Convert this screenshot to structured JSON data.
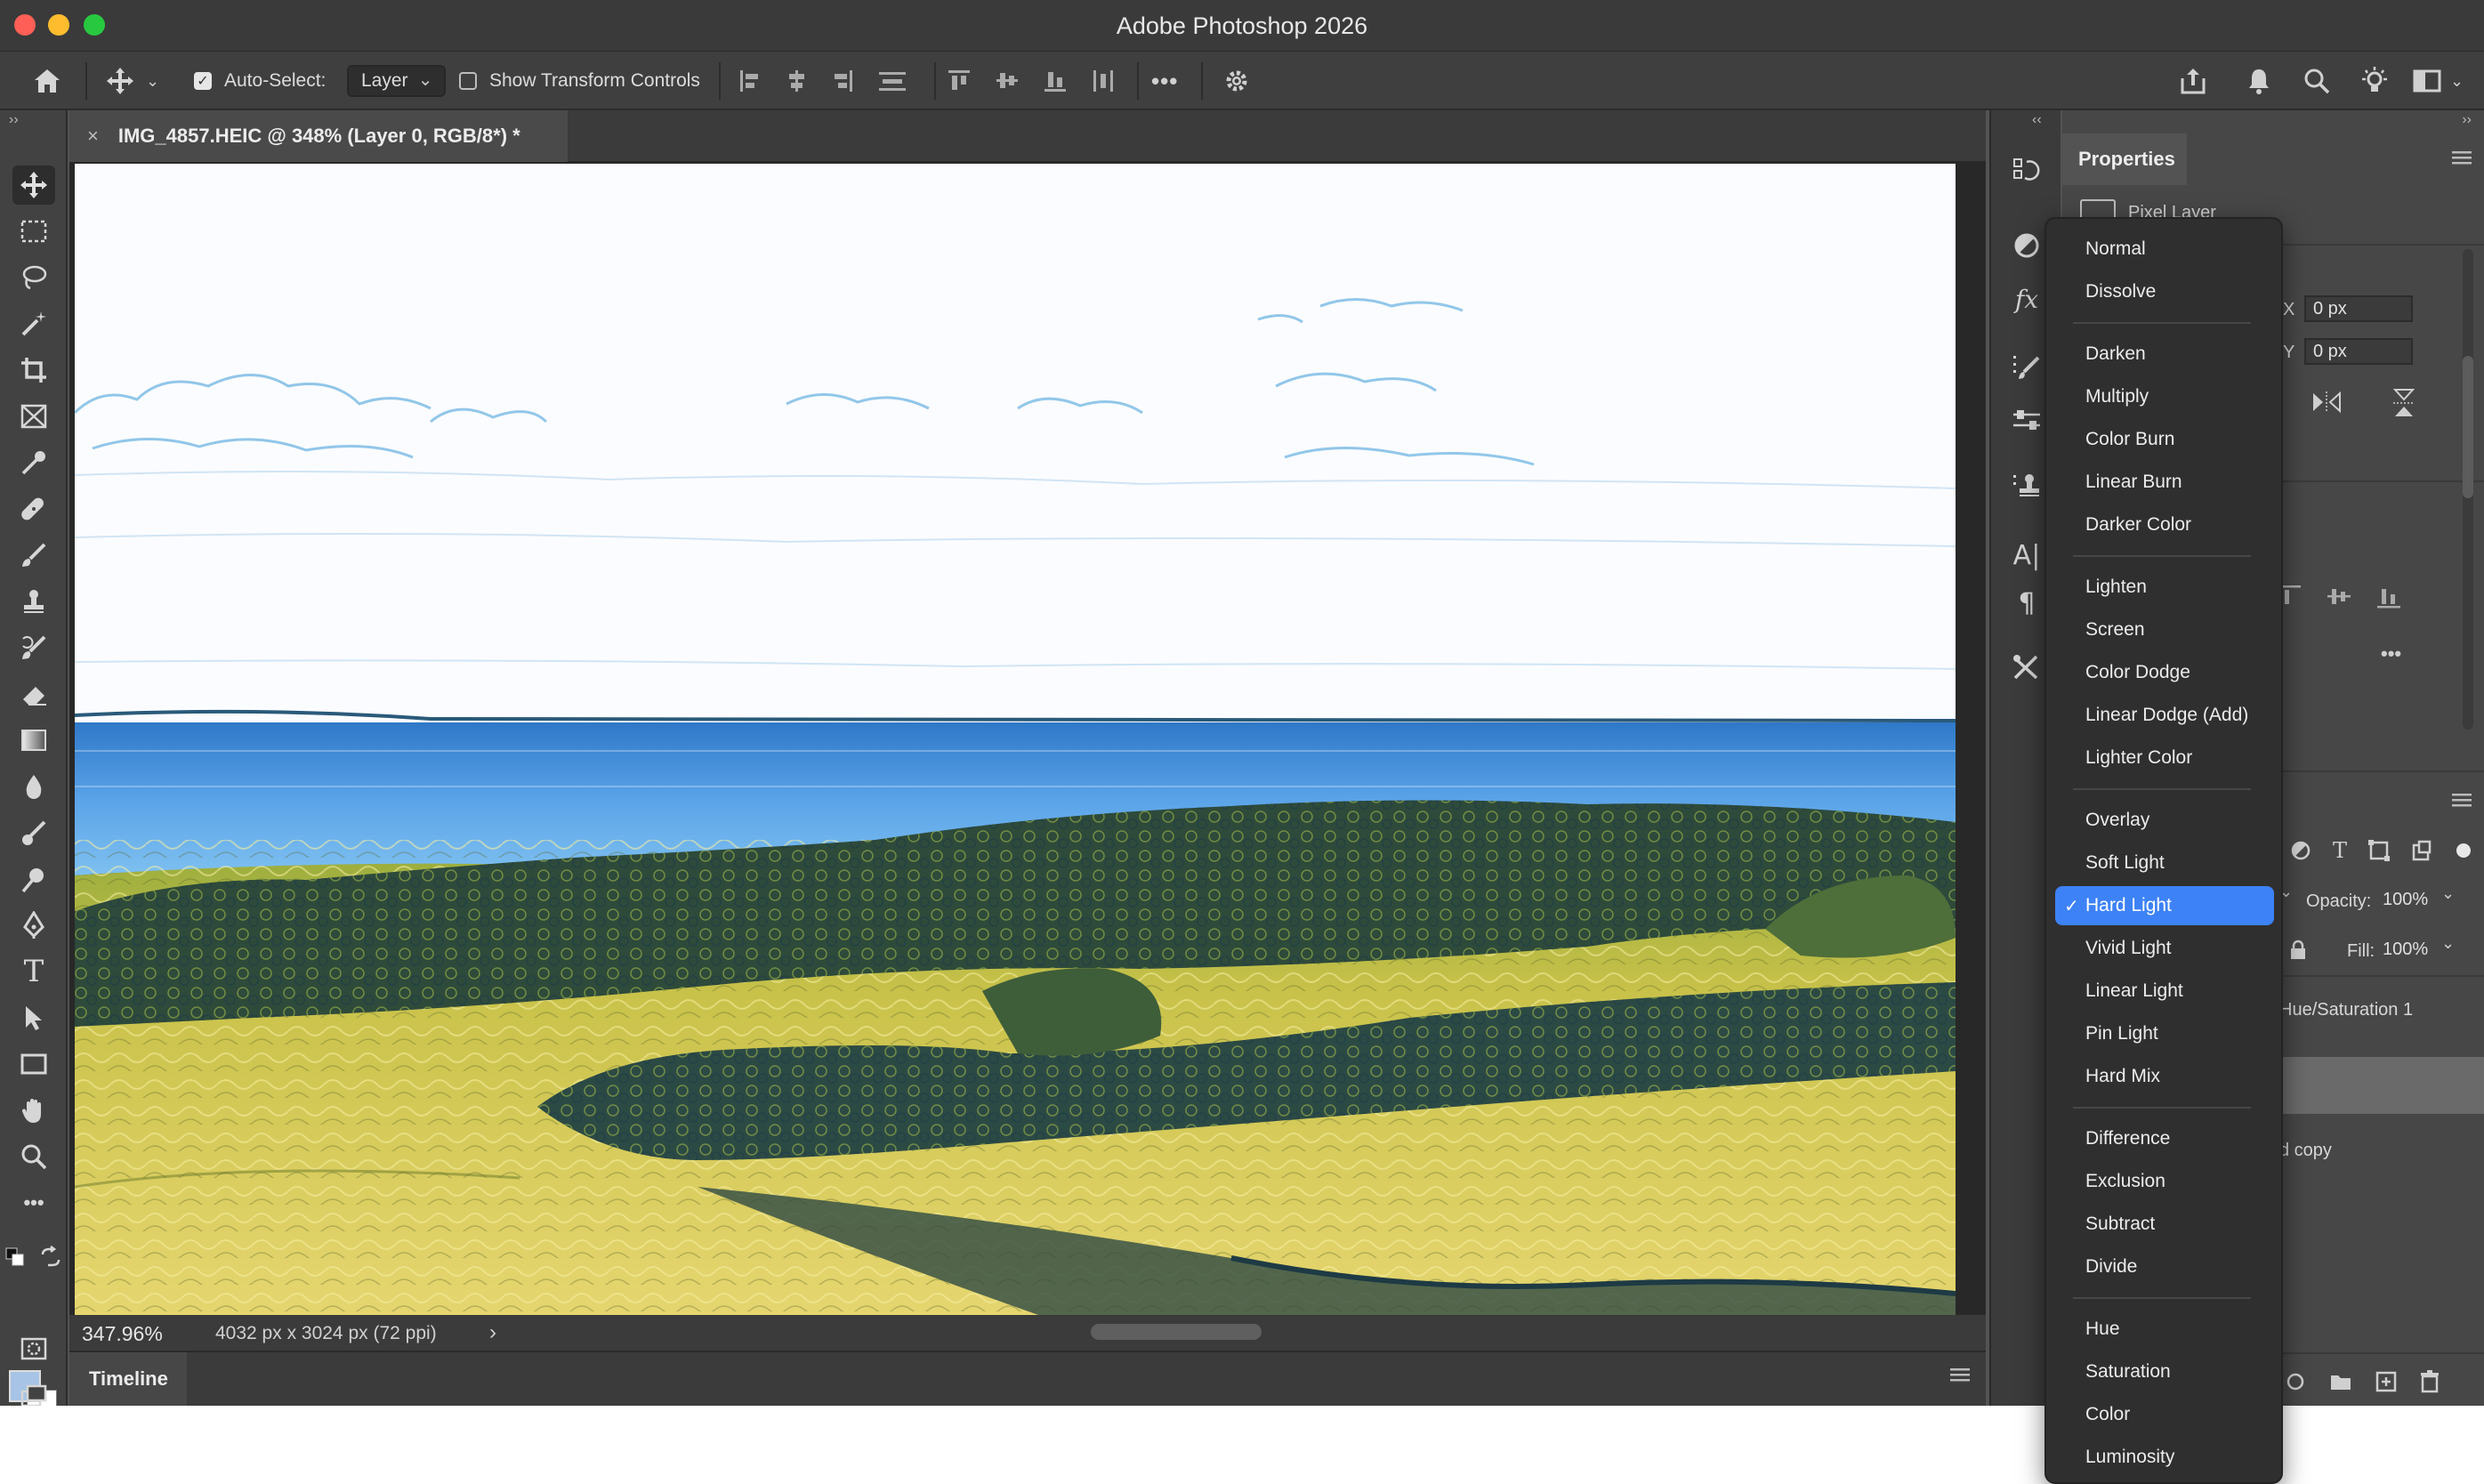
{
  "app": {
    "title": "Adobe Photoshop 2026"
  },
  "options": {
    "auto_select_label": "Auto-Select:",
    "auto_select_checked": true,
    "target": "Layer",
    "show_transform_label": "Show Transform Controls",
    "show_transform_checked": false,
    "more": "•••"
  },
  "document": {
    "tab_title": "IMG_4857.HEIC @ 348% (Layer 0, RGB/8*) *",
    "close": "×"
  },
  "status": {
    "zoom": "347.96%",
    "dimensions": "4032 px x 3024 px (72 ppi)",
    "arrow": "›"
  },
  "timeline": {
    "label": "Timeline"
  },
  "properties": {
    "title": "Properties",
    "layer_type": "Pixel Layer",
    "x_label": "X",
    "x_value": "0 px",
    "y_label": "Y",
    "y_value": "0 px",
    "opacity_label": "Opacity:",
    "opacity_value": "100%",
    "fill_label": "Fill:",
    "fill_value": "100%",
    "layer1_name": "Hue/Saturation 1",
    "layer3_name": "d copy"
  },
  "blend_modes": {
    "selected": "Hard Light",
    "check": "✓",
    "groups": [
      [
        "Normal",
        "Dissolve"
      ],
      [
        "Darken",
        "Multiply",
        "Color Burn",
        "Linear Burn",
        "Darker Color"
      ],
      [
        "Lighten",
        "Screen",
        "Color Dodge",
        "Linear Dodge (Add)",
        "Lighter Color"
      ],
      [
        "Overlay",
        "Soft Light",
        "Hard Light",
        "Vivid Light",
        "Linear Light",
        "Pin Light",
        "Hard Mix"
      ],
      [
        "Difference",
        "Exclusion",
        "Subtract",
        "Divide"
      ],
      [
        "Hue",
        "Saturation",
        "Color",
        "Luminosity"
      ]
    ]
  },
  "colors": {
    "accent": "#3d82f6",
    "foreground": "#a7c4e6",
    "background": "#ffffff"
  }
}
